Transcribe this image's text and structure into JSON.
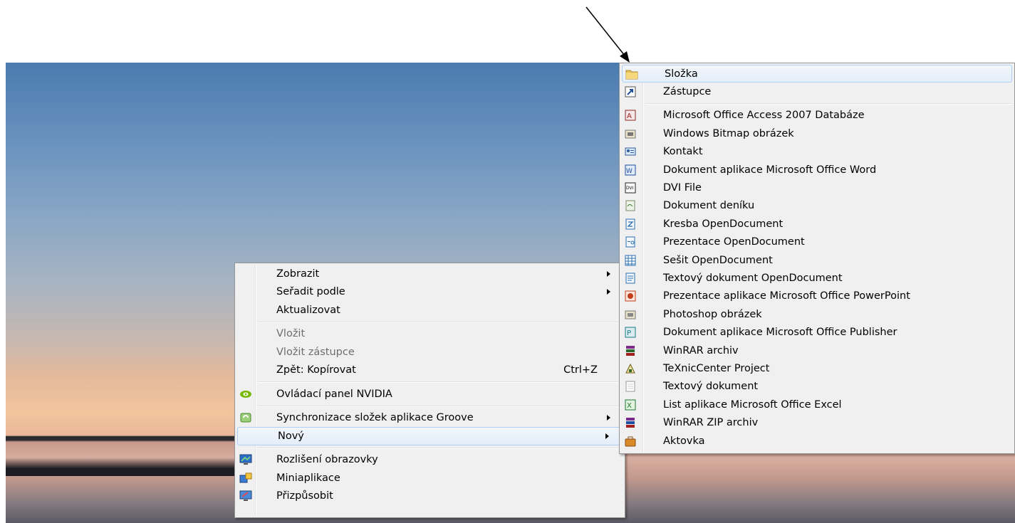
{
  "context_menu": {
    "items": [
      {
        "label": "Zobrazit",
        "submenu": true
      },
      {
        "label": "Seřadit podle",
        "submenu": true
      },
      {
        "label": "Aktualizovat"
      },
      {
        "label": "Vložit",
        "disabled": true
      },
      {
        "label": "Vložit zástupce",
        "disabled": true
      },
      {
        "label": "Zpět: Kopírovat",
        "shortcut": "Ctrl+Z"
      },
      {
        "label": "Ovládací panel NVIDIA",
        "icon": "nvidia-icon"
      },
      {
        "label": "Synchronizace složek aplikace Groove",
        "icon": "groove-icon",
        "submenu": true
      },
      {
        "label": "Nový",
        "submenu": true,
        "highlighted": true
      },
      {
        "label": "Rozlišení obrazovky",
        "icon": "display-icon"
      },
      {
        "label": "Miniaplikace",
        "icon": "gadgets-icon"
      },
      {
        "label": "Přizpůsobit",
        "icon": "personalize-icon"
      }
    ]
  },
  "new_submenu": {
    "items": [
      {
        "label": "Složka",
        "icon": "folder-icon",
        "highlighted": true
      },
      {
        "label": "Zástupce",
        "icon": "shortcut-icon"
      },
      {
        "label": "Microsoft Office Access 2007 Databáze",
        "icon": "access-icon"
      },
      {
        "label": "Windows Bitmap obrázek",
        "icon": "bitmap-icon"
      },
      {
        "label": "Kontakt",
        "icon": "contact-icon"
      },
      {
        "label": "Dokument aplikace Microsoft Office Word",
        "icon": "word-icon"
      },
      {
        "label": "DVI File",
        "icon": "dvi-icon"
      },
      {
        "label": "Dokument deníku",
        "icon": "journal-icon"
      },
      {
        "label": "Kresba OpenDocument",
        "icon": "odg-icon"
      },
      {
        "label": "Prezentace OpenDocument",
        "icon": "odp-icon"
      },
      {
        "label": "Sešit OpenDocument",
        "icon": "ods-icon"
      },
      {
        "label": "Textový dokument OpenDocument",
        "icon": "odt-icon"
      },
      {
        "label": "Prezentace aplikace Microsoft Office PowerPoint",
        "icon": "powerpoint-icon"
      },
      {
        "label": "Photoshop obrázek",
        "icon": "photoshop-icon"
      },
      {
        "label": "Dokument aplikace Microsoft Office Publisher",
        "icon": "publisher-icon"
      },
      {
        "label": "WinRAR archiv",
        "icon": "winrar-icon"
      },
      {
        "label": "TeXnicCenter Project",
        "icon": "texniccenter-icon"
      },
      {
        "label": "Textový dokument",
        "icon": "text-icon"
      },
      {
        "label": "List aplikace Microsoft Office Excel",
        "icon": "excel-icon"
      },
      {
        "label": "WinRAR ZIP archiv",
        "icon": "winrar-zip-icon"
      },
      {
        "label": "Aktovka",
        "icon": "briefcase-icon"
      }
    ]
  },
  "colors": {
    "menu_bg": "#f0f0f0",
    "highlight_border": "#aecff7",
    "disabled_text": "#6d6d6d"
  }
}
